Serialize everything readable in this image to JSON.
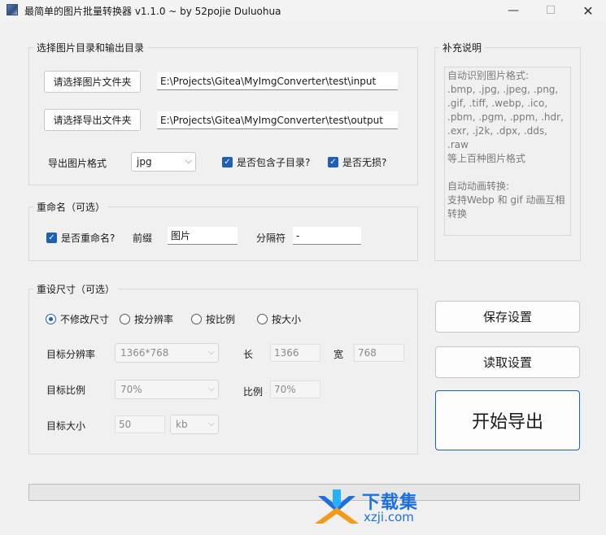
{
  "window": {
    "title": "最简单的图片批量转换器 v1.1.0 ~ by 52pojie Duluohua",
    "minimize": "—",
    "maximize": "☐",
    "close": "✕"
  },
  "dirs": {
    "group_label": "选择图片目录和输出目录",
    "select_input_btn": "请选择图片文件夹",
    "input_path": "E:\\Projects\\Gitea\\MyImgConverter\\test\\input",
    "select_output_btn": "请选择导出文件夹",
    "output_path": "E:\\Projects\\Gitea\\MyImgConverter\\test\\output",
    "format_label": "导出图片格式",
    "format_value": "jpg",
    "include_subdirs_label": "是否包含子目录?",
    "include_subdirs_checked": true,
    "lossless_label": "是否无损?",
    "lossless_checked": true
  },
  "rename": {
    "group_label": "重命名（可选）",
    "rename_label": "是否重命名?",
    "rename_checked": true,
    "prefix_label": "前缀",
    "prefix_value": "图片",
    "separator_label": "分隔符",
    "separator_value": "-"
  },
  "resize": {
    "group_label": "重设尺寸（可选）",
    "options": [
      "不修改尺寸",
      "按分辨率",
      "按比例",
      "按大小"
    ],
    "selected_option": "不修改尺寸",
    "target_resolution_label": "目标分辨率",
    "target_resolution_value": "1366*768",
    "length_label": "长",
    "length_value": "1366",
    "width_label": "宽",
    "width_value": "768",
    "target_ratio_label": "目标比例",
    "target_ratio_value": "70%",
    "ratio_label": "比例",
    "ratio_value": "70%",
    "target_size_label": "目标大小",
    "target_size_value": "50",
    "size_unit": "kb"
  },
  "notes": {
    "group_label": "补充说明",
    "text": "自动识别图片格式:\n.bmp, .jpg, .jpeg, .png,\n.gif, .tiff, .webp, .ico,\n.pbm, .pgm, .ppm, .hdr,\n.exr, .j2k, .dpx, .dds, .raw\n等上百种图片格式\n\n自动动画转换:\n支持Webp 和 gif 动画互相\n转换"
  },
  "actions": {
    "save_settings": "保存设置",
    "load_settings": "读取设置",
    "start_export": "开始导出"
  },
  "progress": {
    "value": 0
  },
  "watermark": {
    "title": "下载集",
    "domain": "xzji.com"
  },
  "colors": {
    "accent": "#1f5fb8",
    "watermark": "#1d6fe0"
  }
}
